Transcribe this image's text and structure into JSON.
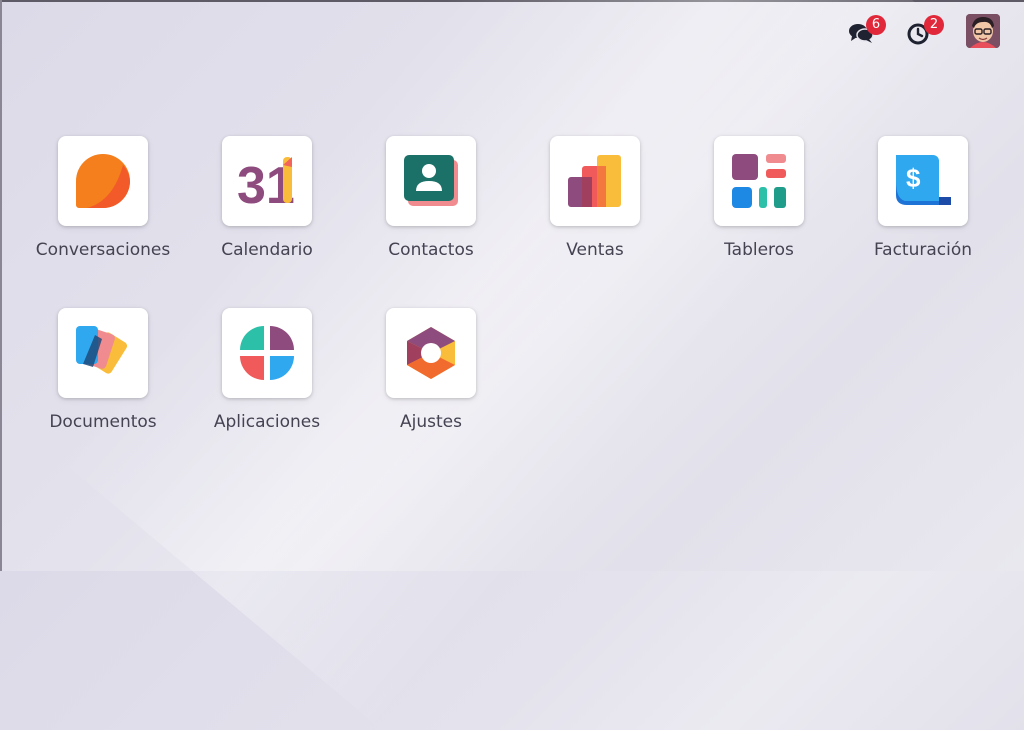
{
  "systray": {
    "messages_count": "6",
    "activities_count": "2",
    "messages_icon": "chat-bubbles-icon",
    "activities_icon": "clock-icon"
  },
  "apps": [
    {
      "label": "Conversaciones",
      "icon": "discuss-icon"
    },
    {
      "label": "Calendario",
      "icon": "calendar-icon",
      "icon_text": "31"
    },
    {
      "label": "Contactos",
      "icon": "contacts-icon"
    },
    {
      "label": "Ventas",
      "icon": "sales-icon"
    },
    {
      "label": "Tableros",
      "icon": "dashboards-icon"
    },
    {
      "label": "Facturación",
      "icon": "invoicing-icon"
    },
    {
      "label": "Documentos",
      "icon": "documents-icon"
    },
    {
      "label": "Aplicaciones",
      "icon": "apps-icon"
    },
    {
      "label": "Ajustes",
      "icon": "settings-icon"
    }
  ],
  "colors": {
    "badge": "#e0283a",
    "label_text": "#454352"
  }
}
